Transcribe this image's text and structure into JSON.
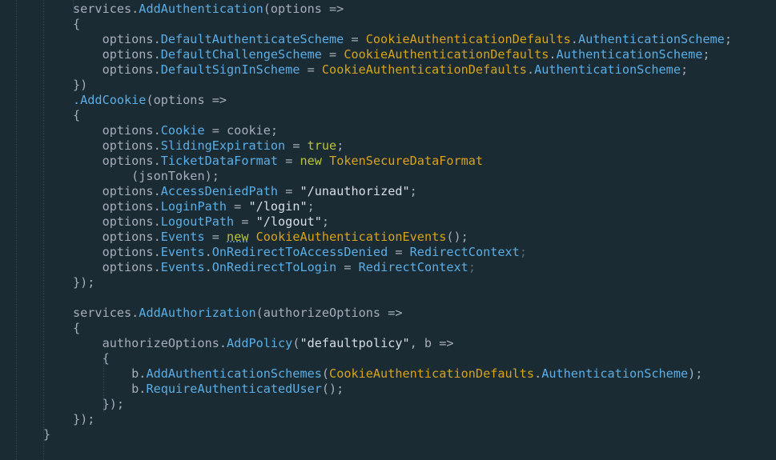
{
  "colors": {
    "background": "#1b2b34",
    "text": "#a7adba",
    "method": "#5aaee6",
    "class": "#d8a31a",
    "string": "#d8dee9",
    "keyword": "#b8c43a"
  },
  "code_lines": [
    [
      {
        "t": "services."
      },
      {
        "m": "AddAuthentication"
      },
      {
        "t": "(options =>"
      }
    ],
    [
      {
        "t": "{"
      }
    ],
    [
      {
        "t": "    options."
      },
      {
        "m": "DefaultAuthenticateScheme"
      },
      {
        "t": " = "
      },
      {
        "c": "CookieAuthenticationDefaults"
      },
      {
        "t": "."
      },
      {
        "m": "AuthenticationScheme"
      },
      {
        "t": ";"
      }
    ],
    [
      {
        "t": "    options."
      },
      {
        "m": "DefaultChallengeScheme"
      },
      {
        "t": " = "
      },
      {
        "c": "CookieAuthenticationDefaults"
      },
      {
        "t": "."
      },
      {
        "m": "AuthenticationScheme"
      },
      {
        "t": ";"
      }
    ],
    [
      {
        "t": "    options."
      },
      {
        "m": "DefaultSignInScheme"
      },
      {
        "t": " = "
      },
      {
        "c": "CookieAuthenticationDefaults"
      },
      {
        "t": "."
      },
      {
        "m": "AuthenticationScheme"
      },
      {
        "t": ";"
      }
    ],
    [
      {
        "t": "})"
      }
    ],
    [
      {
        "m": ".AddCookie"
      },
      {
        "t": "(options =>"
      }
    ],
    [
      {
        "t": "{"
      }
    ],
    [
      {
        "t": "    options."
      },
      {
        "m": "Cookie"
      },
      {
        "t": " = cookie;"
      }
    ],
    [
      {
        "t": "    options."
      },
      {
        "m": "SlidingExpiration"
      },
      {
        "t": " = "
      },
      {
        "k": "true"
      },
      {
        "t": ";"
      }
    ],
    [
      {
        "t": "    options."
      },
      {
        "m": "TicketDataFormat"
      },
      {
        "t": " = "
      },
      {
        "k": "new"
      },
      {
        "t": " "
      },
      {
        "c": "TokenSecureDataFormat"
      }
    ],
    [
      {
        "t": "        (jsonToken);"
      }
    ],
    [
      {
        "t": "    options."
      },
      {
        "m": "AccessDeniedPath"
      },
      {
        "t": " = "
      },
      {
        "s": "\"/unauthorized\""
      },
      {
        "t": ";"
      }
    ],
    [
      {
        "t": "    options."
      },
      {
        "m": "LoginPath"
      },
      {
        "t": " = "
      },
      {
        "s": "\"/login\""
      },
      {
        "t": ";"
      }
    ],
    [
      {
        "t": "    options."
      },
      {
        "m": "LogoutPath"
      },
      {
        "t": " = "
      },
      {
        "s": "\"/logout\""
      },
      {
        "t": ";"
      }
    ],
    [
      {
        "t": "    options."
      },
      {
        "m": "Events"
      },
      {
        "t": " = "
      },
      {
        "k": "new",
        "sq": true
      },
      {
        "t": " "
      },
      {
        "c": "CookieAuthenticationEvents"
      },
      {
        "t": "();"
      }
    ],
    [
      {
        "t": "    options."
      },
      {
        "m": "Events"
      },
      {
        "t": "."
      },
      {
        "m": "OnRedirectToAccessDenied"
      },
      {
        "t": " = "
      },
      {
        "m": "RedirectContext"
      },
      {
        "dim": ";"
      }
    ],
    [
      {
        "t": "    options."
      },
      {
        "m": "Events"
      },
      {
        "t": "."
      },
      {
        "m": "OnRedirectToLogin"
      },
      {
        "t": " = "
      },
      {
        "m": "RedirectContext"
      },
      {
        "dim": ";"
      }
    ],
    [
      {
        "t": "});"
      }
    ],
    [],
    [
      {
        "t": "services."
      },
      {
        "m": "AddAuthorization"
      },
      {
        "t": "(authorizeOptions =>"
      }
    ],
    [
      {
        "t": "{"
      }
    ],
    [
      {
        "t": "    authorizeOptions."
      },
      {
        "m": "AddPolicy"
      },
      {
        "t": "("
      },
      {
        "s": "\"defaultpolicy\""
      },
      {
        "t": ", b =>"
      }
    ],
    [
      {
        "t": "    {"
      }
    ],
    [
      {
        "t": "        b."
      },
      {
        "m": "AddAuthenticationSchemes"
      },
      {
        "t": "("
      },
      {
        "c": "CookieAuthenticationDefaults"
      },
      {
        "t": "."
      },
      {
        "m": "AuthenticationScheme"
      },
      {
        "t": ");"
      }
    ],
    [
      {
        "t": "        b."
      },
      {
        "m": "RequireAuthenticatedUser"
      },
      {
        "t": "();"
      }
    ],
    [
      {
        "t": "    });"
      }
    ],
    [
      {
        "t": "});"
      }
    ],
    [
      {
        "t": "}"
      }
    ]
  ]
}
